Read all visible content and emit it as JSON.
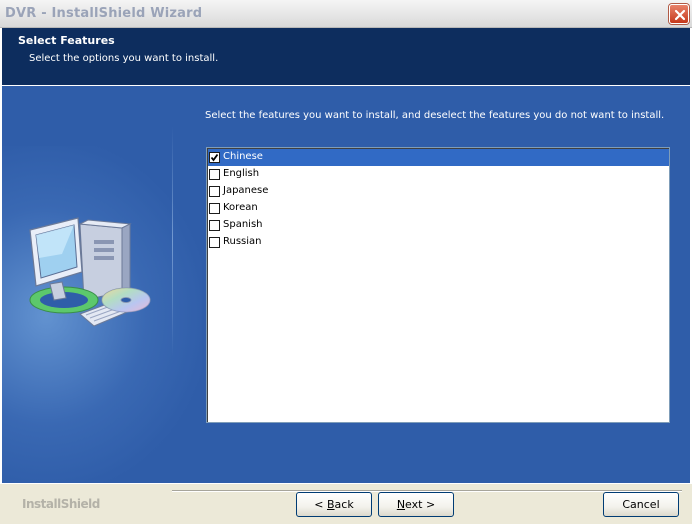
{
  "window": {
    "title": "DVR - InstallShield Wizard"
  },
  "header": {
    "title": "Select Features",
    "subtitle": "Select the options you want to install."
  },
  "main": {
    "instruction": "Select the features you want to install, and deselect the features you do not want to install.",
    "features": [
      {
        "label": "Chinese",
        "checked": true,
        "selected": true
      },
      {
        "label": "English",
        "checked": false,
        "selected": false
      },
      {
        "label": "Japanese",
        "checked": false,
        "selected": false
      },
      {
        "label": "Korean",
        "checked": false,
        "selected": false
      },
      {
        "label": "Spanish",
        "checked": false,
        "selected": false
      },
      {
        "label": "Russian",
        "checked": false,
        "selected": false
      }
    ]
  },
  "footer": {
    "brand": "InstallShield",
    "back_label_mnemonic": "B",
    "back_label_rest": "ack",
    "back_prefix": "< ",
    "next_label_mnemonic": "N",
    "next_label_rest": "ext >",
    "cancel_label": "Cancel"
  },
  "icons": {
    "close": "close-icon",
    "checkbox": "checkmark-icon",
    "illustration": "computer-cd-icon"
  },
  "colors": {
    "header_bg": "#0d2d5e",
    "body_bg": "#2f5da9",
    "selection": "#316ac5",
    "close_button": "#c5391c"
  }
}
